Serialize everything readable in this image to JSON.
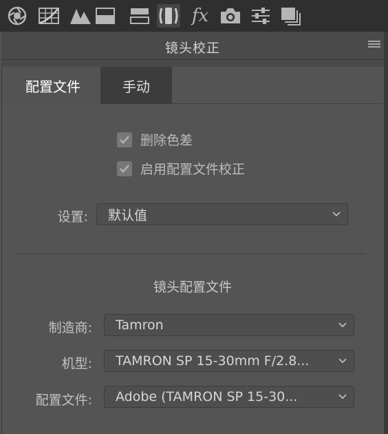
{
  "toolbar": {
    "icons": [
      "aperture-icon",
      "tone-curve-icon",
      "detail-icon",
      "hsl-icon",
      "split-toning-icon",
      "lens-corrections-icon",
      "fx-icon",
      "camera-calibration-icon",
      "presets-icon",
      "snapshots-icon"
    ],
    "fx_label": "fx",
    "active_icon": "lens-corrections-icon"
  },
  "panel": {
    "title": "镜头校正"
  },
  "tabs": [
    {
      "label": "配置文件",
      "active": true
    },
    {
      "label": "手动",
      "active": false
    }
  ],
  "checkboxes": [
    {
      "label": "删除色差",
      "checked": true
    },
    {
      "label": "启用配置文件校正",
      "checked": true
    }
  ],
  "setup": {
    "label": "设置:",
    "value": "默认值"
  },
  "lens_profile": {
    "section_title": "镜头配置文件",
    "make": {
      "label": "制造商:",
      "value": "Tamron"
    },
    "model": {
      "label": "机型:",
      "value": "TAMRON SP 15-30mm F/2.8..."
    },
    "profile": {
      "label": "配置文件:",
      "value": "Adobe (TAMRON SP 15-30..."
    }
  },
  "colors": {
    "toolbar_bg": "#2f2f2f",
    "panel_bg": "#535353",
    "active_tab_text": "#ffffff"
  }
}
